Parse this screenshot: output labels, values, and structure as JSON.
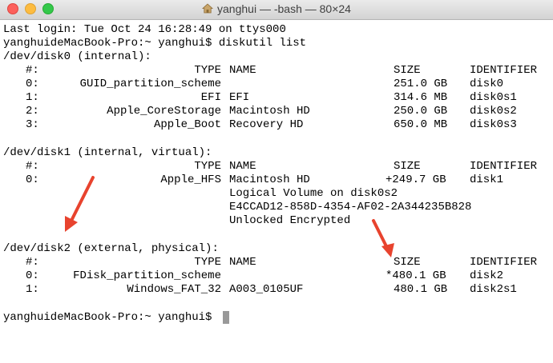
{
  "window": {
    "title": "yanghui — -bash — 80×24",
    "icon": "home-folder-icon"
  },
  "colors": {
    "annotation_arrow": "#e8432e",
    "cursor": "#999999"
  },
  "terminal": {
    "last_login": "Last login: Tue Oct 24 16:28:49 on ttys000",
    "prompt1": "yanghuideMacBook-Pro:~ yanghui$ diskutil list",
    "disk0": {
      "header": "/dev/disk0 (internal):",
      "col_num": "#:",
      "col_type": "TYPE",
      "col_name": "NAME",
      "col_size": "SIZE",
      "col_id": "IDENTIFIER",
      "rows": [
        {
          "num": "0:",
          "type": "GUID_partition_scheme",
          "name": "",
          "size": "251.0 GB",
          "id": "disk0"
        },
        {
          "num": "1:",
          "type": "EFI",
          "name": "EFI",
          "size": "314.6 MB",
          "id": "disk0s1"
        },
        {
          "num": "2:",
          "type": "Apple_CoreStorage",
          "name": "Macintosh HD",
          "size": "250.0 GB",
          "id": "disk0s2"
        },
        {
          "num": "3:",
          "type": "Apple_Boot",
          "name": "Recovery HD",
          "size": "650.0 MB",
          "id": "disk0s3"
        }
      ]
    },
    "disk1": {
      "header": "/dev/disk1 (internal, virtual):",
      "col_num": "#:",
      "col_type": "TYPE",
      "col_name": "NAME",
      "col_size": "SIZE",
      "col_id": "IDENTIFIER",
      "rows": [
        {
          "num": "0:",
          "type": "Apple_HFS",
          "name": "Macintosh HD",
          "size": "+249.7 GB",
          "id": "disk1"
        }
      ],
      "extra": [
        "Logical Volume on disk0s2",
        "E4CCAD12-858D-4354-AF02-2A344235B828",
        "Unlocked Encrypted"
      ]
    },
    "disk2": {
      "header": "/dev/disk2 (external, physical):",
      "col_num": "#:",
      "col_type": "TYPE",
      "col_name": "NAME",
      "col_size": "SIZE",
      "col_id": "IDENTIFIER",
      "rows": [
        {
          "num": "0:",
          "type": "FDisk_partition_scheme",
          "name": "",
          "size": "*480.1 GB",
          "id": "disk2"
        },
        {
          "num": "1:",
          "type": "Windows_FAT_32",
          "name": "A003_0105UF",
          "size": "480.1 GB",
          "id": "disk2s1"
        }
      ]
    },
    "prompt2": "yanghuideMacBook-Pro:~ yanghui$"
  }
}
